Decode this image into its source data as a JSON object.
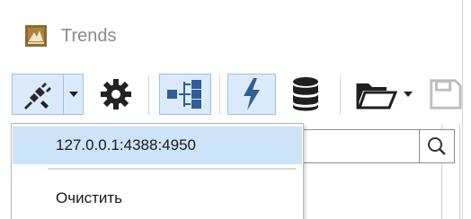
{
  "window": {
    "title": "Trends"
  },
  "colors": {
    "accent_active_bg": "#dbeafb",
    "accent_icon": "#2f5f95",
    "icon_dark": "#1f1f1f",
    "menu_highlight": "#cde3f7",
    "logo_brown": "#8c6a2c"
  },
  "toolbar": {
    "icons": [
      "connect-plug-icon",
      "chevron-down-icon",
      "gear-icon",
      "network-tree-icon",
      "lightning-icon",
      "database-icon",
      "folder-open-icon",
      "chevron-down-icon",
      "save-icon"
    ]
  },
  "search": {
    "value": "",
    "icon": "search-icon"
  },
  "connect_menu": {
    "items": [
      {
        "label": "127.0.0.1:4388:4950",
        "highlighted": true
      },
      {
        "label": "Очистить",
        "highlighted": false
      }
    ]
  }
}
